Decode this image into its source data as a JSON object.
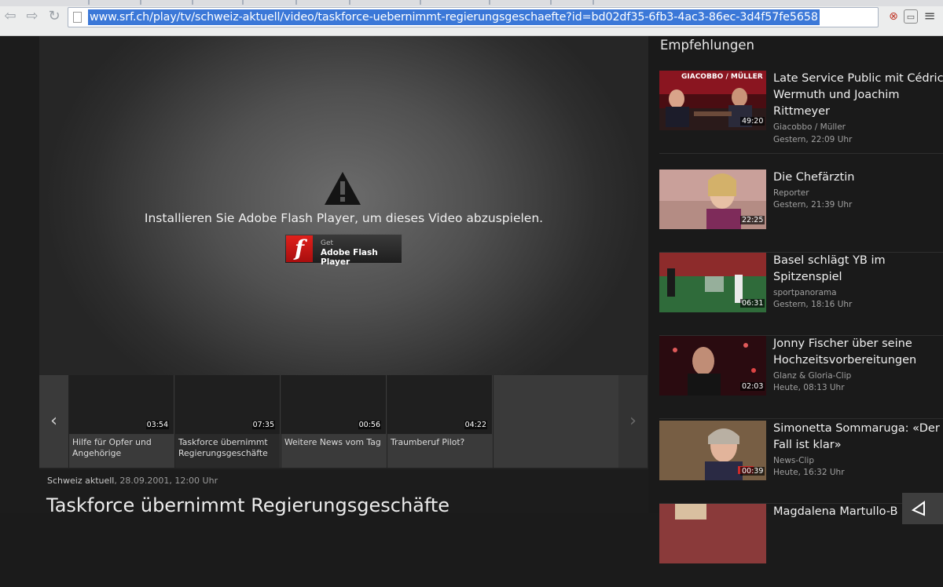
{
  "browser": {
    "url": "www.srf.ch/play/tv/schweiz-aktuell/video/taskforce-uebernimmt-regierungsgeschaefte?id=bd02df35-6fb3-4ac3-86ec-3d4f57fe5658"
  },
  "player": {
    "flash_message": "Installieren Sie Adobe Flash Player, um dieses Video abzuspielen.",
    "flash_button_get": "Get",
    "flash_button_name": "Adobe Flash Player"
  },
  "carousel": {
    "prev": "‹",
    "next": "›",
    "items": [
      {
        "duration": "03:54",
        "title": "Hilfe für Opfer und Angehörige"
      },
      {
        "duration": "07:35",
        "title": "Taskforce übernimmt Regierungsgeschäfte"
      },
      {
        "duration": "00:56",
        "title": "Weitere News vom Tag"
      },
      {
        "duration": "04:22",
        "title": "Traumberuf Pilot?"
      }
    ]
  },
  "video": {
    "show": "Schweiz aktuell",
    "date": ", 28.09.2001, 12:00 Uhr",
    "title": "Taskforce übernimmt Regierungsgeschäfte"
  },
  "sidebar": {
    "heading": "Empfehlungen",
    "items": [
      {
        "title1": "Late Service Public mit Cédric",
        "title2": "Wermuth und Joachim",
        "title3": "Rittmeyer",
        "show": "Giacobbo / Müller",
        "time": "Gestern, 22:09 Uhr",
        "duration": "49:20",
        "thumb_overlay": "GIACOBBO / MÜLLER"
      },
      {
        "title1": "Die Chefärztin",
        "show": "Reporter",
        "time": "Gestern, 21:39 Uhr",
        "duration": "22:25"
      },
      {
        "title1": "Basel schlägt YB im",
        "title2": "Spitzenspiel",
        "show": "sportpanorama",
        "time": "Gestern, 18:16 Uhr",
        "duration": "06:31"
      },
      {
        "title1": "Jonny Fischer über seine",
        "title2": "Hochzeitsvorbereitungen",
        "show": "Glanz & Gloria-Clip",
        "time": "Heute, 08:13 Uhr",
        "duration": "02:03"
      },
      {
        "title1": "Simonetta Sommaruga: «Der",
        "title2": "Fall ist klar»",
        "show": "News-Clip",
        "time": "Heute, 16:32 Uhr",
        "duration": "00:39"
      },
      {
        "title1": "Magdalena Martullo-B"
      }
    ]
  },
  "colors": {
    "url_highlight": "#3b78d8",
    "flash_red": "#d81a16",
    "page_bg": "#1c1c1c"
  }
}
